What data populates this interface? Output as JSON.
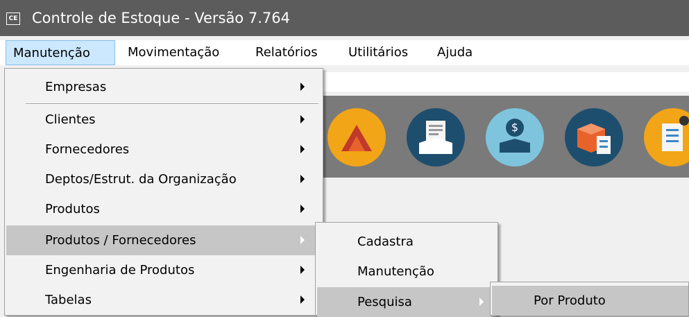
{
  "window": {
    "icon_text": "CE",
    "title": "Controle de Estoque - Versão 7.764"
  },
  "menubar": {
    "items": [
      {
        "label": "Manutenção"
      },
      {
        "label": "Movimentação"
      },
      {
        "label": "Relatórios"
      },
      {
        "label": "Utilitários"
      },
      {
        "label": "Ajuda"
      }
    ]
  },
  "toolbar": {
    "icons": [
      "document-icon",
      "open-box-document-icon",
      "money-box-icon",
      "box-checklist-icon",
      "checklist-location-icon"
    ]
  },
  "menu_manutencao": {
    "items": [
      {
        "label": "Empresas",
        "has_submenu": true
      },
      {
        "label": "Clientes",
        "has_submenu": true
      },
      {
        "label": "Fornecedores",
        "has_submenu": true
      },
      {
        "label": "Deptos/Estrut. da Organização",
        "has_submenu": true
      },
      {
        "label": "Produtos",
        "has_submenu": true
      },
      {
        "label": "Produtos / Fornecedores",
        "has_submenu": true,
        "highlighted": true
      },
      {
        "label": "Engenharia de Produtos",
        "has_submenu": true
      },
      {
        "label": "Tabelas",
        "has_submenu": true
      }
    ]
  },
  "menu_produtos_fornecedores": {
    "items": [
      {
        "label": "Cadastra"
      },
      {
        "label": "Manutenção"
      },
      {
        "label": "Pesquisa",
        "has_submenu": true,
        "highlighted": true
      }
    ]
  },
  "menu_pesquisa": {
    "items": [
      {
        "label": "Por Produto",
        "highlighted": true
      }
    ]
  },
  "colors": {
    "titlebar": "#5c5c5c",
    "menu_bg": "#f2f2f2",
    "highlight": "#c6c6c6",
    "toolbar_band": "#7a7a7a"
  }
}
